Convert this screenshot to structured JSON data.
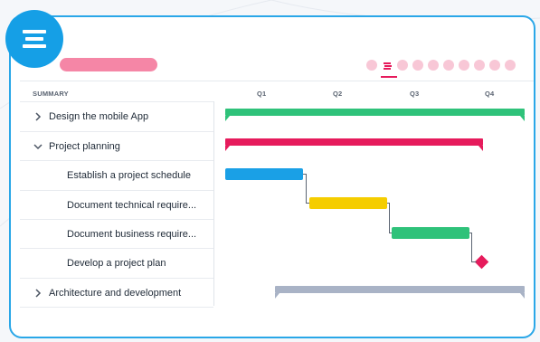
{
  "header": {
    "summary_label": "SUMMARY",
    "quarters": [
      "Q1",
      "Q2",
      "Q3",
      "Q4"
    ]
  },
  "rows": [
    {
      "label": "Design the mobile App",
      "expand": "collapsed"
    },
    {
      "label": "Project planning",
      "expand": "expanded"
    },
    {
      "label": "Establish a project schedule",
      "expand": "none"
    },
    {
      "label": "Document technical require...",
      "expand": "none"
    },
    {
      "label": "Document business require...",
      "expand": "none"
    },
    {
      "label": "Develop a project plan",
      "expand": "none"
    },
    {
      "label": "Architecture and development",
      "expand": "collapsed"
    }
  ],
  "colors": {
    "accent_blue": "#159fe6",
    "border_blue": "#2aa7e8",
    "pink_title": "#f586a6",
    "green": "#2fc27a",
    "crimson": "#e61b5c",
    "task_blue": "#1aa0e6",
    "yellow": "#f5cd00",
    "slate": "#a9b3c6"
  },
  "icons": {
    "menu": "hamburger-menu-icon",
    "collapsed": "chevron-right-icon",
    "expanded": "chevron-down-icon"
  },
  "pagination": {
    "count": 10,
    "active_index": 1
  }
}
